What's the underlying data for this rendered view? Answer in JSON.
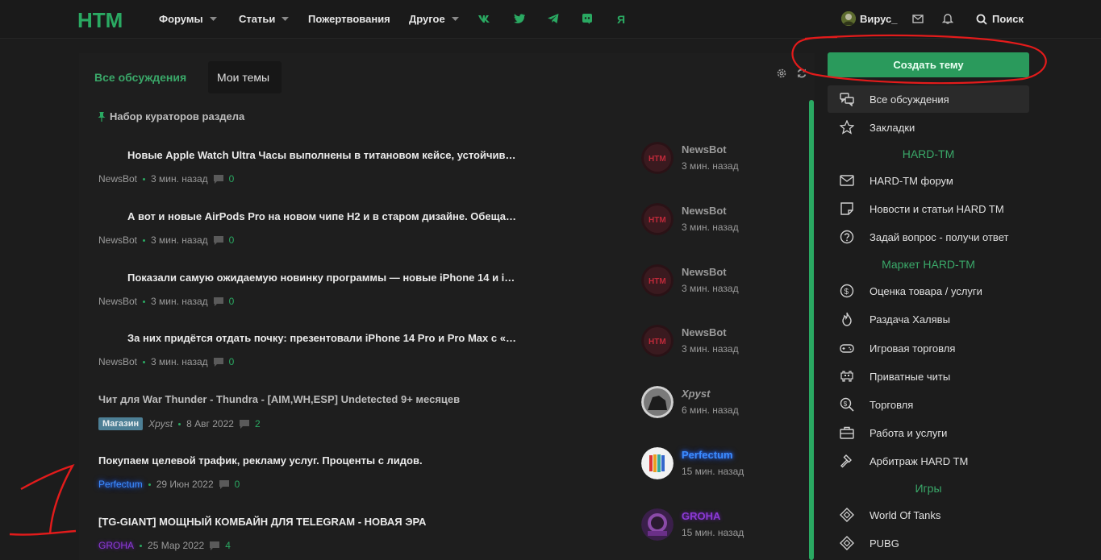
{
  "header": {
    "logo_text": "HTM",
    "nav": [
      {
        "label": "Форумы",
        "has_menu": true
      },
      {
        "label": "Статьи",
        "has_menu": true
      },
      {
        "label": "Пожертвования",
        "has_menu": false
      },
      {
        "label": "Другое",
        "has_menu": true
      }
    ],
    "social_icons": [
      "vk-icon",
      "twitter-icon",
      "telegram-icon",
      "discord-icon",
      "yandex-icon"
    ],
    "yandex_glyph": "Я",
    "username": "Вирус_",
    "search_label": "Поиск"
  },
  "tabs": {
    "all": "Все обсуждения",
    "mine": "Мои темы"
  },
  "pinned_label": "Набор кураторов раздела",
  "threads": [
    {
      "title": "Новые Apple Watch Ultra Часы выполнены в титановом кейсе, устойчив…",
      "author": "NewsBot",
      "time": "3 мин. назад",
      "replies": "0",
      "last_user": "NewsBot",
      "last_time": "3 мин. назад"
    },
    {
      "title": "А вот и новые AirPods Pro на новом чипе H2 и в старом дизайне. Обеща…",
      "author": "NewsBot",
      "time": "3 мин. назад",
      "replies": "0",
      "last_user": "NewsBot",
      "last_time": "3 мин. назад"
    },
    {
      "title": "Показали самую ожидаемую новинку программы — новые iPhone 14 и i…",
      "author": "NewsBot",
      "time": "3 мин. назад",
      "replies": "0",
      "last_user": "NewsBot",
      "last_time": "3 мин. назад"
    },
    {
      "title": "За них придётся отдать почку: презентовали iPhone 14 Pro и Pro Max с «…",
      "author": "NewsBot",
      "time": "3 мин. назад",
      "replies": "0",
      "last_user": "NewsBot",
      "last_time": "3 мин. назад"
    },
    {
      "title": "Чит для War Thunder - Thundra - [AIM,WH,ESP] Undetected 9+ месяцев",
      "prefix": "Магазин",
      "author": "Xpyst",
      "time": "8 Авг 2022",
      "replies": "2",
      "last_user": "Xpyst",
      "last_time": "6 мин. назад"
    },
    {
      "title": "Покупаем целевой трафик, рекламу услуг. Проценты с лидов.",
      "author": "Perfectum",
      "time": "29 Июн 2022",
      "replies": "0",
      "last_user": "Perfectum",
      "last_time": "15 мин. назад"
    },
    {
      "title": "[TG-GIANT] МОЩНЫЙ КОМБАЙН ДЛЯ TELEGRAM - НОВАЯ ЭРА",
      "author": "GROHA",
      "time": "25 Мар 2022",
      "replies": "4",
      "last_user": "GROHA",
      "last_time": "15 мин. назад"
    }
  ],
  "sidebar": {
    "create_label": "Создать тему",
    "items": [
      {
        "label": "Все обсуждения",
        "icon": "chat-icon"
      },
      {
        "label": "Закладки",
        "icon": "star-icon"
      },
      {
        "label": "HARD-TM форум",
        "icon": "mail-icon"
      },
      {
        "label": "Новости и статьи HARD TM",
        "icon": "note-icon"
      },
      {
        "label": "Задай вопрос - получи ответ",
        "icon": "question-icon"
      },
      {
        "label": "Оценка товара / услуги",
        "icon": "dollar-icon"
      },
      {
        "label": "Раздача Халявы",
        "icon": "fire-icon"
      },
      {
        "label": "Игровая торговля",
        "icon": "gamepad-icon"
      },
      {
        "label": "Приватные читы",
        "icon": "invader-icon"
      },
      {
        "label": "Торговля",
        "icon": "search-dollar-icon"
      },
      {
        "label": "Работа и услуги",
        "icon": "briefcase-icon"
      },
      {
        "label": "Арбитраж HARD TM",
        "icon": "gavel-icon"
      },
      {
        "label": "World Of Tanks",
        "icon": "tank-icon"
      },
      {
        "label": "PUBG",
        "icon": "pubg-icon"
      }
    ],
    "headers": [
      "HARD-TM",
      "Маркет HARD-TM",
      "Игры"
    ]
  },
  "colors": {
    "accent": "#2a9a5c",
    "background": "#1c1c1c",
    "annotation": "#e31b1b"
  }
}
